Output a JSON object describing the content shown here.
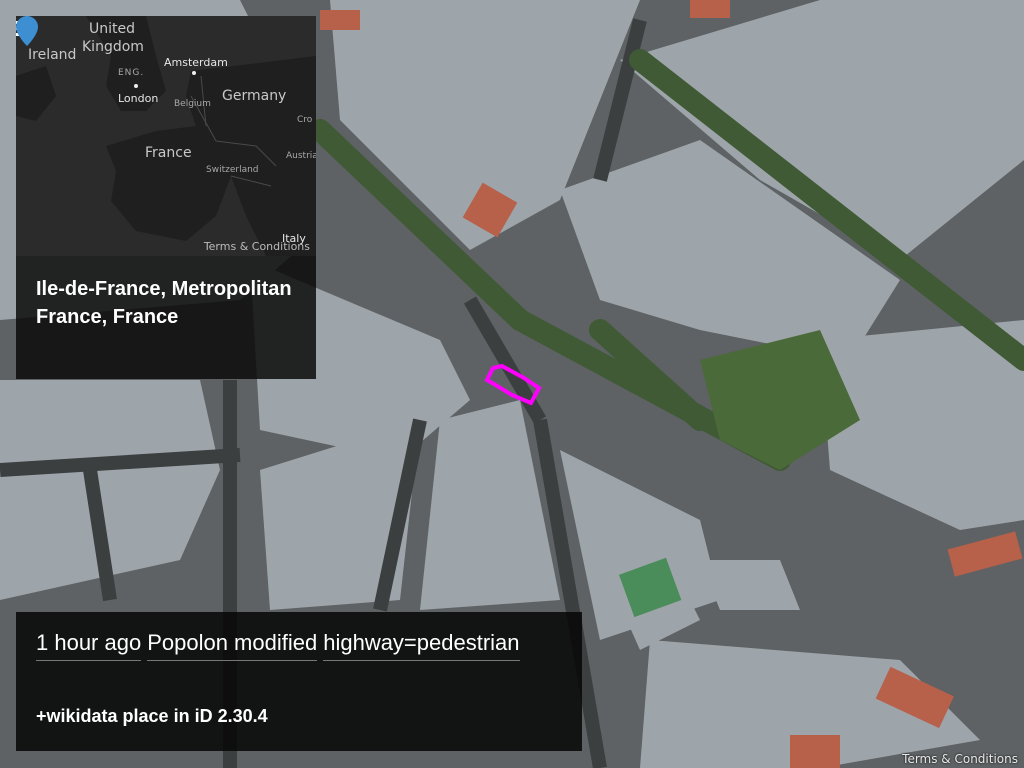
{
  "menu": {
    "icon": "hamburger-menu-icon"
  },
  "inset_map": {
    "labels": {
      "ireland": "Ireland",
      "united_kingdom": "United Kingdom",
      "eng": "ENG.",
      "amsterdam": "Amsterdam",
      "london": "London",
      "germany": "Germany",
      "belgium": "Belgium",
      "france": "France",
      "switzerland": "Switzerland",
      "austria": "Austria",
      "croatia": "Cro",
      "italy": "Italy"
    },
    "pin_icon": "location-pin-icon",
    "pin_color": "#3d8fd1",
    "terms": "Terms & Conditions"
  },
  "place": {
    "name": "Ile-de-France, Metropolitan France, France"
  },
  "event": {
    "time_ago": "1 hour ago",
    "user_action": "Popolon modified",
    "tag": "highway=pedestrian",
    "comment": "+wikidata place in iD 2.30.4"
  },
  "map": {
    "highlight_color": "#ff00ff",
    "terms": "Terms & Conditions"
  }
}
